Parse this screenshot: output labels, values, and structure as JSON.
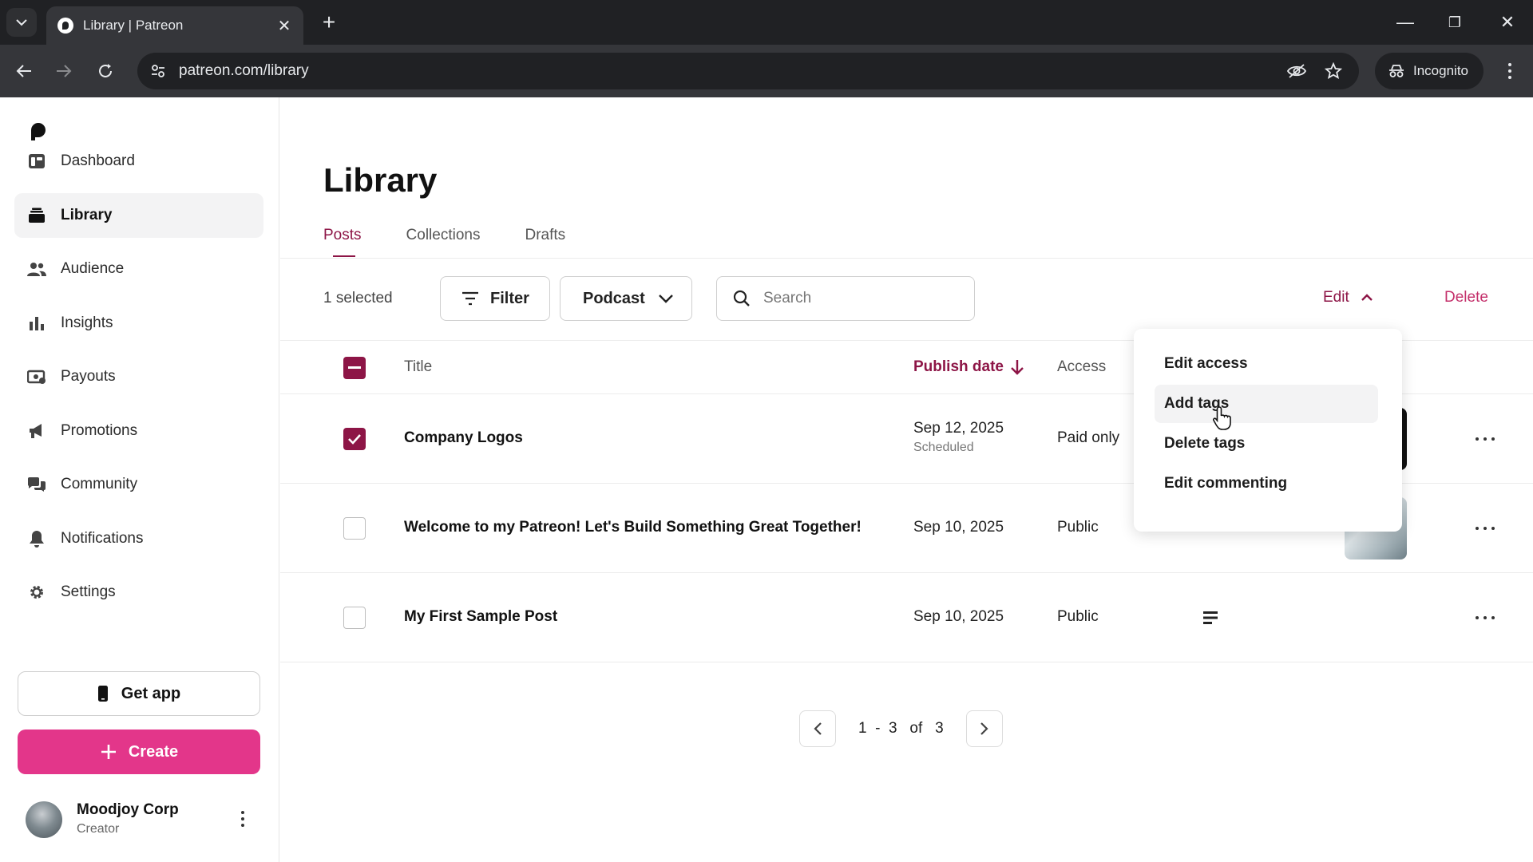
{
  "browser": {
    "tab_title": "Library | Patreon",
    "url": "patreon.com/library",
    "incognito_label": "Incognito"
  },
  "sidebar": {
    "items": [
      {
        "label": "Dashboard",
        "icon": "dashboard-icon"
      },
      {
        "label": "Library",
        "icon": "library-icon",
        "active": true
      },
      {
        "label": "Audience",
        "icon": "audience-icon"
      },
      {
        "label": "Insights",
        "icon": "insights-icon"
      },
      {
        "label": "Payouts",
        "icon": "payouts-icon"
      },
      {
        "label": "Promotions",
        "icon": "promotions-icon"
      },
      {
        "label": "Community",
        "icon": "community-icon"
      },
      {
        "label": "Notifications",
        "icon": "bell-icon"
      },
      {
        "label": "Settings",
        "icon": "gear-icon"
      }
    ],
    "get_app_label": "Get app",
    "create_label": "Create",
    "profile": {
      "name": "Moodjoy Corp",
      "role": "Creator"
    }
  },
  "main": {
    "title": "Library",
    "tabs": [
      {
        "label": "Posts",
        "active": true
      },
      {
        "label": "Collections"
      },
      {
        "label": "Drafts"
      }
    ],
    "toolbar": {
      "selected_text": "1 selected",
      "filter_label": "Filter",
      "podcast_label": "Podcast",
      "search_placeholder": "Search",
      "edit_label": "Edit",
      "delete_label": "Delete"
    },
    "table": {
      "headers": {
        "title": "Title",
        "publish_date": "Publish date",
        "access": "Access"
      },
      "rows": [
        {
          "title": "Company Logos",
          "date": "Sep 12, 2025",
          "status": "Scheduled",
          "access": "Paid only",
          "checked": true
        },
        {
          "title": "Welcome to my Patreon! Let's Build Something Great Together!",
          "date": "Sep 10, 2025",
          "access": "Public",
          "checked": false
        },
        {
          "title": "My First Sample Post",
          "date": "Sep 10, 2025",
          "access": "Public",
          "checked": false
        }
      ]
    },
    "pagination": {
      "text": "1  -  3   of   3"
    },
    "edit_menu": {
      "items": [
        "Edit access",
        "Add tags",
        "Delete tags",
        "Edit commenting"
      ],
      "hovered": "Add tags"
    }
  },
  "colors": {
    "accent": "#8d1546",
    "create": "#e3368a",
    "delete": "#c4306b"
  }
}
